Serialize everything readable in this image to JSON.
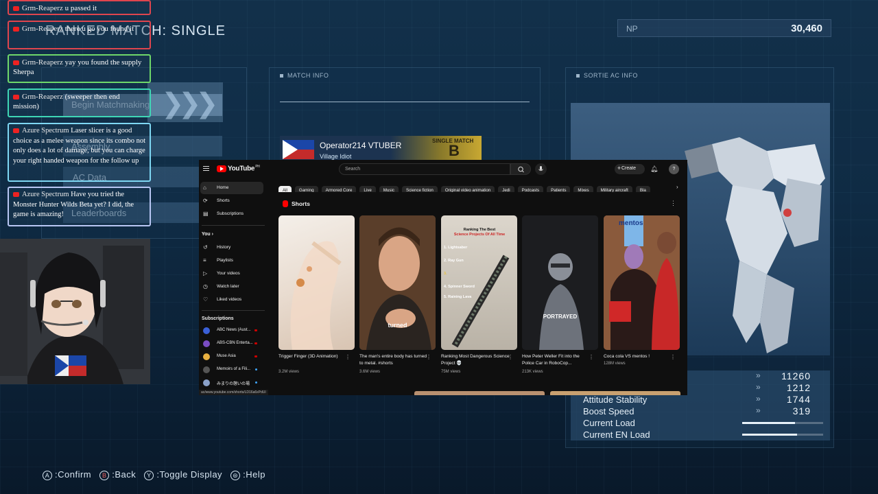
{
  "game": {
    "title": "RANKED MATCH: SINGLE",
    "np_label": "NP",
    "np_value": "30,460",
    "match_info_label": "MATCH INFO",
    "sortie_label": "SORTIE AC INFO",
    "menu": [
      "Begin Matchmaking",
      "Assembly",
      "AC Data",
      "Leaderboards"
    ],
    "match_card": {
      "name": "Operator214 VTUBER",
      "rank_text": "Village Idiot",
      "tag": "SINGLE MATCH",
      "grade": "B"
    },
    "stats": [
      {
        "label": "",
        "value": "11260"
      },
      {
        "label": "",
        "value": "1212"
      },
      {
        "label": "Attitude Stability",
        "value": "1744"
      },
      {
        "label": "Boost Speed",
        "value": "319"
      }
    ],
    "loads": [
      {
        "label": "Current Load",
        "fill": 0.65
      },
      {
        "label": "Current EN Load",
        "fill": 0.68
      }
    ],
    "help": [
      {
        "icon": "A",
        "label": ":Confirm"
      },
      {
        "icon": "B",
        "label": ":Back"
      },
      {
        "icon": "Y",
        "label": ":Toggle Display"
      },
      {
        "icon": "⊜",
        "label": ":Help"
      }
    ]
  },
  "chat": [
    {
      "author": "Grm-Reaperz",
      "text": "u passed it",
      "color": "red"
    },
    {
      "author": "Grm-Reaperz",
      "text": "there u go you found it",
      "color": "red"
    },
    {
      "author": "Grm-Reaperz",
      "text": "yay you found the supply Sherpa",
      "color": "green"
    },
    {
      "author": "Grm-Reaperz",
      "text": "(sweeper then end mission)",
      "color": "teal"
    },
    {
      "author": "Azure Spectrum",
      "text": "Laser slicer is a good choice as a melee weapon since its combo not only does a lot of damage, but you can charge your right handed weapon for the follow up",
      "color": "blue"
    },
    {
      "author": "Azure Spectrum",
      "text": "Have you tried the Monster Hunter Wilds Beta yet? I did, the game is amazing!",
      "color": "lav"
    }
  ],
  "youtube": {
    "logo_text": "YouTube",
    "logo_sup": "PH",
    "search_placeholder": "Search",
    "create_label": "Create",
    "sidebar": [
      {
        "label": "Home",
        "icon": "⌂"
      },
      {
        "label": "Shorts",
        "icon": "⟳"
      },
      {
        "label": "Subscriptions",
        "icon": "▤"
      }
    ],
    "you_heading": "You",
    "you_items": [
      {
        "label": "History",
        "icon": "↺"
      },
      {
        "label": "Playlists",
        "icon": "≡"
      },
      {
        "label": "Your videos",
        "icon": "▷"
      },
      {
        "label": "Watch later",
        "icon": "◷"
      },
      {
        "label": "Liked videos",
        "icon": "♡"
      }
    ],
    "subs_heading": "Subscriptions",
    "subscriptions": [
      {
        "label": "ABC News (Aust...",
        "color": "#3a5fd6",
        "dot": true
      },
      {
        "label": "ABS-CBN Enterta...",
        "color": "#7a4cc2",
        "dot": true
      },
      {
        "label": "Muse Asia",
        "color": "#e8b040",
        "dot": true
      },
      {
        "label": "Memoirs of a Fili...",
        "color": "#555555",
        "dot": false
      },
      {
        "label": "みまりの憩いの場",
        "color": "#8aa0c8",
        "dot": false
      }
    ],
    "chips": [
      "All",
      "Gaming",
      "Armored Core",
      "Live",
      "Music",
      "Science fiction",
      "Original video animation",
      "Jedi",
      "Podcasts",
      "Patients",
      "Mixes",
      "Military aircraft",
      "Bla"
    ],
    "shorts_title": "Shorts",
    "shorts": [
      {
        "title": "Trigger Finger (3D Animation)",
        "views": "3.2M views",
        "caption": ""
      },
      {
        "title": "The man's entire body has turned to metal. #shorts",
        "views": "3.6M views",
        "caption": "turned"
      },
      {
        "title": "Ranking Most Dangerous Science Project 💀",
        "views": "75M views",
        "caption": ""
      },
      {
        "title": "How Peter Weller Fit into the Police Car in RoboCop...",
        "views": "213K views",
        "caption": "PORTRAYED"
      },
      {
        "title": "Coca cola VS mentos !",
        "views": "128M views",
        "caption": ""
      }
    ],
    "ranking_overlay": [
      "Ranking The Best",
      "Science Projects Of All Time",
      "1. Lightsaber",
      "2. Ray Gun",
      "3.",
      "4. Spinner Sword",
      "5. Raining Lava"
    ],
    "mentos_label": "mentos",
    "url": "ac/www.youtube.com/shorts/LD16a6xPdUI"
  }
}
